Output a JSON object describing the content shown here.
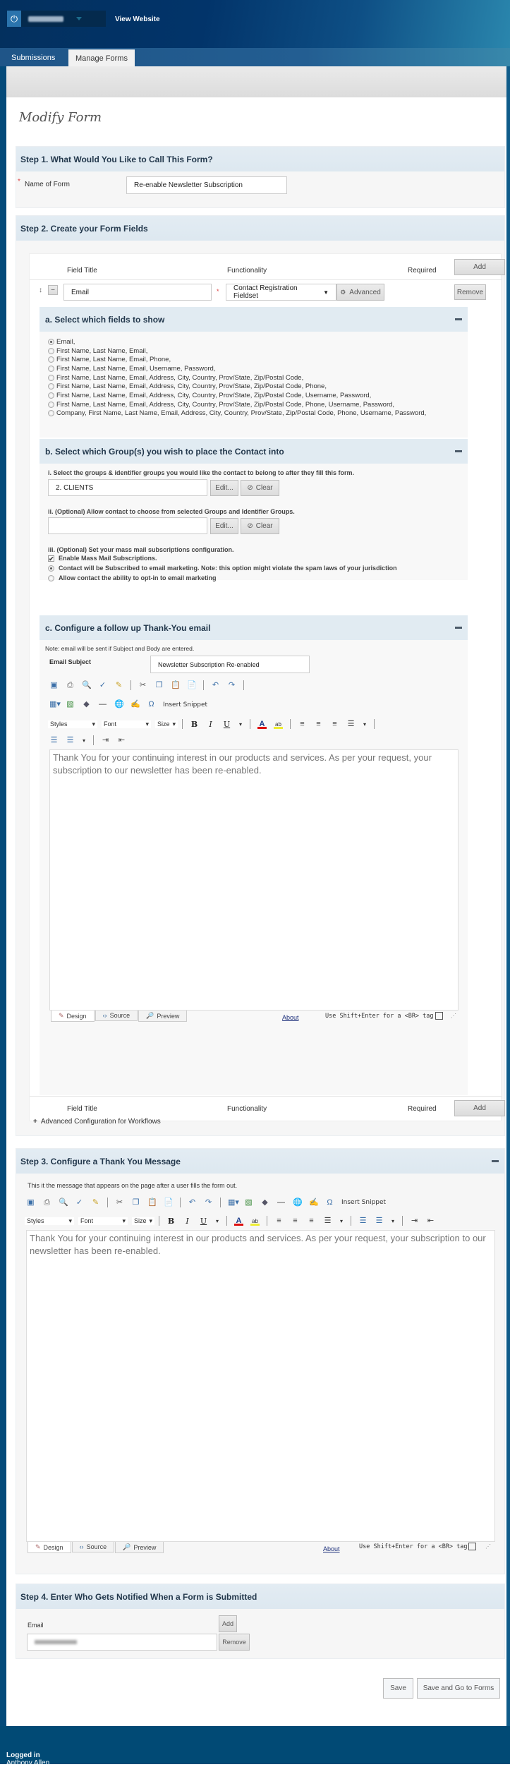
{
  "header": {
    "user_name_blurred": "Anthony Allen",
    "view_website": "View Website",
    "tabs": [
      {
        "label": "Submissions",
        "active": false
      },
      {
        "label": "Manage Forms",
        "active": true
      }
    ]
  },
  "page_title": "Modify Form",
  "step1": {
    "title": "Step 1. What Would You Like to Call This Form?",
    "name_label": "Name of Form",
    "required_mark": "*",
    "name_value": "Re-enable Newsletter Subscription"
  },
  "step2": {
    "title": "Step 2. Create your Form Fields",
    "columns": {
      "field_title": "Field Title",
      "functionality": "Functionality",
      "required": "Required"
    },
    "add_label": "Add",
    "field": {
      "title_value": "Email",
      "required_mark": "*",
      "functionality": "Contact Registration Fieldset",
      "advanced_label": "Advanced",
      "remove_label": "Remove"
    },
    "sub_a": {
      "title": "a. Select which fields to show",
      "options": [
        "Email,",
        "First Name, Last Name, Email,",
        "First Name, Last Name, Email, Phone,",
        "First Name, Last Name, Email, Username, Password,",
        "First Name, Last Name, Email, Address, City, Country, Prov/State, Zip/Postal Code,",
        "First Name, Last Name, Email, Address, City, Country, Prov/State, Zip/Postal Code, Phone,",
        "First Name, Last Name, Email, Address, City, Country, Prov/State, Zip/Postal Code, Username, Password,",
        "First Name, Last Name, Email, Address, City, Country, Prov/State, Zip/Postal Code, Phone, Username, Password,",
        "Company, First Name, Last Name, Email, Address, City, Country, Prov/State, Zip/Postal Code, Phone, Username, Password,"
      ],
      "selected_index": 0
    },
    "sub_b": {
      "title": "b. Select which Group(s) you wish to place the Contact into",
      "i_label": "i. Select the groups & identifier groups you would like the contact to belong to after they fill this form.",
      "i_value": "2. CLIENTS",
      "ii_label": "ii. (Optional) Allow contact to choose from selected Groups and Identifier Groups.",
      "ii_value": "",
      "edit_label": "Edit...",
      "clear_label": "Clear",
      "iii_label": "iii. (Optional) Set your mass mail subscriptions configuration.",
      "enable_mass_mail": "Enable Mass Mail Subscriptions.",
      "enable_mass_mail_checked": true,
      "opt_subscribed": "Contact will be Subscribed to email marketing. Note: this option might violate the spam laws of your jurisdiction",
      "opt_optin": "Allow contact the ability to opt-in to email marketing",
      "selected_option": "subscribed"
    },
    "sub_c": {
      "title": "c. Configure a follow up Thank-You email",
      "note": "Note: email will be sent if Subject and Body are entered.",
      "subject_label": "Email Subject",
      "subject_value": "Newsletter Subscription Re-enabled",
      "body": "Thank You for your continuing interest in our products and services. As per your request, your subscription to our newsletter has been re-enabled."
    },
    "advanced_workflows": "Advanced Configuration for Workflows"
  },
  "editor": {
    "insert_snippet": "Insert Snippet",
    "styles": "Styles",
    "font": "Font",
    "size": "Size",
    "modes": [
      "Design",
      "Source",
      "Preview"
    ],
    "about": "About",
    "hint": "Use Shift+Enter for a <BR> tag"
  },
  "step3": {
    "title": "Step 3. Configure a Thank You Message",
    "description": "This it the message that appears on the page after a user fills the form out.",
    "body": "Thank You for your continuing interest in our products and services. As per your request, your subscription to our newsletter has been re-enabled."
  },
  "step4": {
    "title": "Step 4. Enter Who Gets Notified When a Form is Submitted",
    "email_label": "Email",
    "add_label": "Add",
    "email_value_blurred": "sales@domain.ca",
    "remove_label": "Remove"
  },
  "actions": {
    "save": "Save",
    "save_go": "Save and Go to Forms"
  },
  "footer": {
    "logged_in": "Logged in",
    "user": "Anthony Allen"
  }
}
